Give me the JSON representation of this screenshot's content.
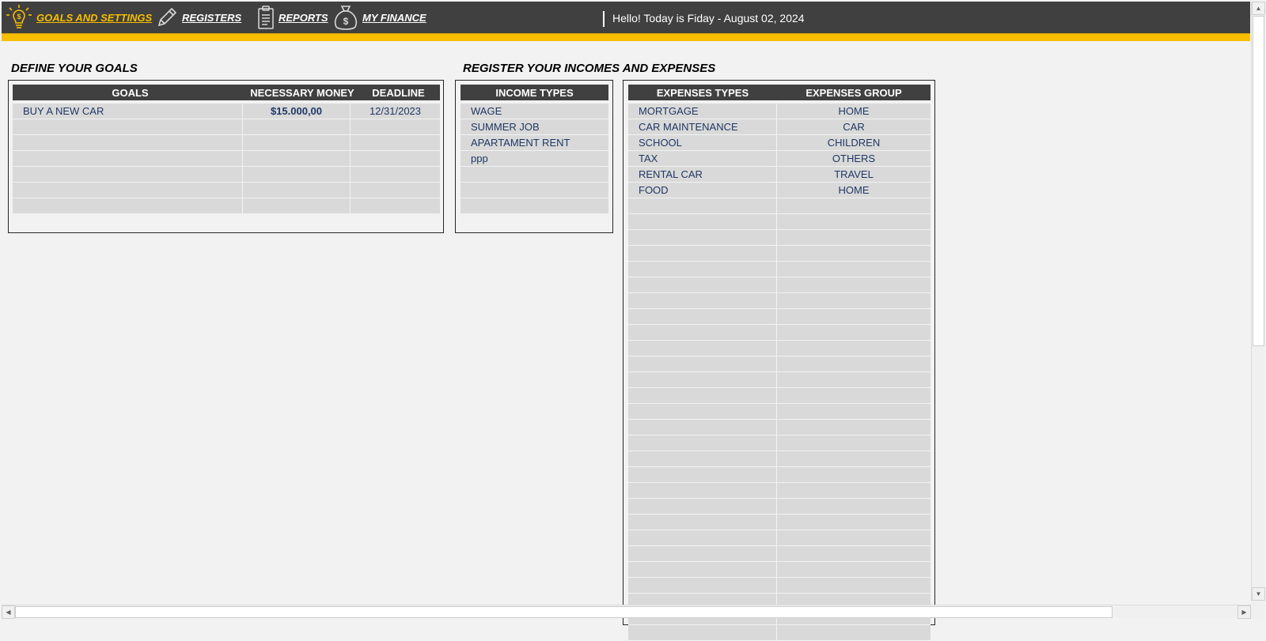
{
  "nav": {
    "items": [
      {
        "label": "GOALS AND SETTINGS",
        "icon": "lightbulb-dollar-icon",
        "active": true
      },
      {
        "label": "REGISTERS",
        "icon": "pencil-icon",
        "active": false
      },
      {
        "label": "REPORTS",
        "icon": "clipboard-icon",
        "active": false
      },
      {
        "label": "MY FINANCE",
        "icon": "money-bag-icon",
        "active": false
      }
    ],
    "greeting": "Hello! Today is Fiday - August 02, 2024"
  },
  "colors": {
    "header_bg": "#404040",
    "accent": "#f7be00",
    "cell_bg": "#d9d9d9",
    "cell_text": "#1f3864"
  },
  "goals_section": {
    "title": "DEFINE YOUR GOALS",
    "headers": [
      "GOALS",
      "NECESSARY MONEY",
      "DEADLINE"
    ],
    "rows": [
      [
        "BUY A NEW CAR",
        "$15.000,00",
        "12/31/2023"
      ],
      [
        "",
        "",
        ""
      ],
      [
        "",
        "",
        ""
      ],
      [
        "",
        "",
        ""
      ],
      [
        "",
        "",
        ""
      ],
      [
        "",
        "",
        ""
      ],
      [
        "",
        "",
        ""
      ]
    ]
  },
  "register_section": {
    "title": "REGISTER YOUR INCOMES AND EXPENSES",
    "income": {
      "headers": [
        "INCOME TYPES"
      ],
      "rows": [
        "WAGE",
        "SUMMER JOB",
        "APARTAMENT RENT",
        "ppp",
        "",
        "",
        ""
      ]
    },
    "expenses": {
      "headers": [
        "EXPENSES TYPES",
        "EXPENSES GROUP"
      ],
      "rows": [
        [
          "MORTGAGE",
          "HOME"
        ],
        [
          "CAR MAINTENANCE",
          "CAR"
        ],
        [
          "SCHOOL",
          "CHILDREN"
        ],
        [
          "TAX",
          "OTHERS"
        ],
        [
          "RENTAL CAR",
          "TRAVEL"
        ],
        [
          "FOOD",
          "HOME"
        ],
        [
          "",
          ""
        ],
        [
          "",
          ""
        ],
        [
          "",
          ""
        ],
        [
          "",
          ""
        ],
        [
          "",
          ""
        ],
        [
          "",
          ""
        ],
        [
          "",
          ""
        ],
        [
          "",
          ""
        ],
        [
          "",
          ""
        ],
        [
          "",
          ""
        ],
        [
          "",
          ""
        ],
        [
          "",
          ""
        ],
        [
          "",
          ""
        ],
        [
          "",
          ""
        ],
        [
          "",
          ""
        ],
        [
          "",
          ""
        ],
        [
          "",
          ""
        ],
        [
          "",
          ""
        ],
        [
          "",
          ""
        ],
        [
          "",
          ""
        ],
        [
          "",
          ""
        ],
        [
          "",
          ""
        ],
        [
          "",
          ""
        ],
        [
          "",
          ""
        ],
        [
          "",
          ""
        ],
        [
          "",
          ""
        ],
        [
          "",
          ""
        ],
        [
          "",
          ""
        ]
      ]
    }
  }
}
